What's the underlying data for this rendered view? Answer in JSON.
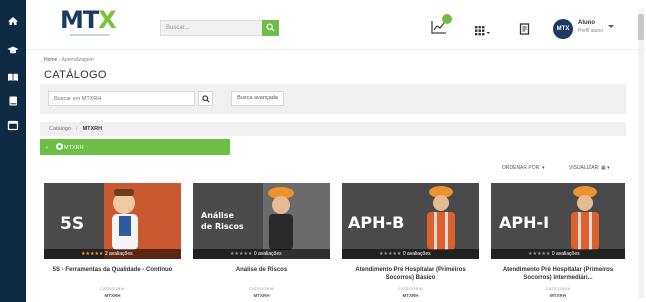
{
  "app": {
    "logo": "MTX",
    "search_placeholder": "Buscar...",
    "user": {
      "initials": "MTX",
      "name": "Aluno",
      "role": "Perfil aluno"
    }
  },
  "breadcrumb": {
    "home": "Home",
    "separator": "›",
    "current": "Aprendizagem"
  },
  "page_title": "CATÁLOGO",
  "catalog_search": {
    "placeholder": "Buscar em MTXRH",
    "advanced_label": "Busca avançada"
  },
  "path": {
    "root": "Catálogo",
    "separator": "/",
    "current": "MTXRH"
  },
  "green_tab": {
    "label": "MTXRH"
  },
  "toolbar": {
    "sort_label": "ORDENAR POR:",
    "view_label": "VISUALIZAR:"
  },
  "courses": [
    {
      "image_text": "5S",
      "stars_filled": 5,
      "rating_text": "2 avaliações",
      "title": "5S - Ferramentas da Qualidade - Contínuo",
      "category_label": "CATEGORIA",
      "category": "MTXRH"
    },
    {
      "image_text": [
        "Análise",
        "de Riscos"
      ],
      "stars_filled": 0,
      "rating_text": "0 avaliações",
      "title": "Análise de Riscos",
      "category_label": "CATEGORIA",
      "category": "MTXRH"
    },
    {
      "image_text": "APH-B",
      "stars_filled": 0,
      "rating_text": "0 avaliações",
      "title": "Atendimento Pré Hospitalar (Primeiros Socorros) Básico",
      "category_label": "CATEGORIA",
      "category": "MTXRH"
    },
    {
      "image_text": "APH-I",
      "stars_filled": 0,
      "rating_text": "0 avaliações",
      "title": "Atendimento Pré Hospitalar (Primeiros Socorros) Intermediári...",
      "category_label": "CATEGORIA",
      "category": "MTXRH"
    }
  ],
  "colors": {
    "rail": "#0f2b43",
    "accent": "#6dbe45",
    "brand": "#1d3a63",
    "card_bg": "#4a4a4a",
    "card_accent": "#e05a2b"
  },
  "icons": [
    "home-icon",
    "graduation-cap-icon",
    "book-open-icon",
    "book-icon",
    "calendar-icon",
    "search-icon",
    "chart-icon",
    "apps-grid-icon",
    "notes-icon",
    "chevron-down-icon"
  ]
}
